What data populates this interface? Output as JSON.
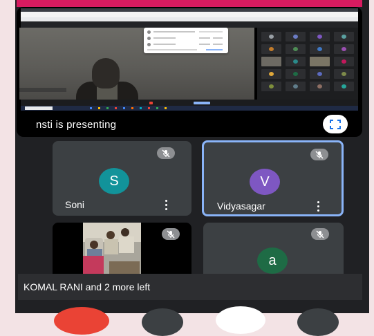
{
  "presentation": {
    "label": "nsti is presenting"
  },
  "participants": [
    {
      "name": "Soni",
      "initial": "S",
      "color": "#12939a",
      "muted": true
    },
    {
      "name": "Vidyasagar",
      "initial": "V",
      "color": "#7e57c2",
      "muted": true,
      "speaking": true
    },
    {
      "name": "",
      "initial": "",
      "muted": true,
      "video": true
    },
    {
      "name": "",
      "initial": "a",
      "color": "#1e6b45",
      "muted": true
    }
  ],
  "notification": {
    "text": "KOMAL RANI and 2 more left"
  },
  "icons": {
    "fullscreen": "fullscreen-icon",
    "mute": "mic-off-icon",
    "more": "more-vert-icon"
  },
  "colors": {
    "background": "#202124",
    "tile": "#3c4043",
    "active_border": "#8ab4f8",
    "end_call": "#ea4335"
  }
}
